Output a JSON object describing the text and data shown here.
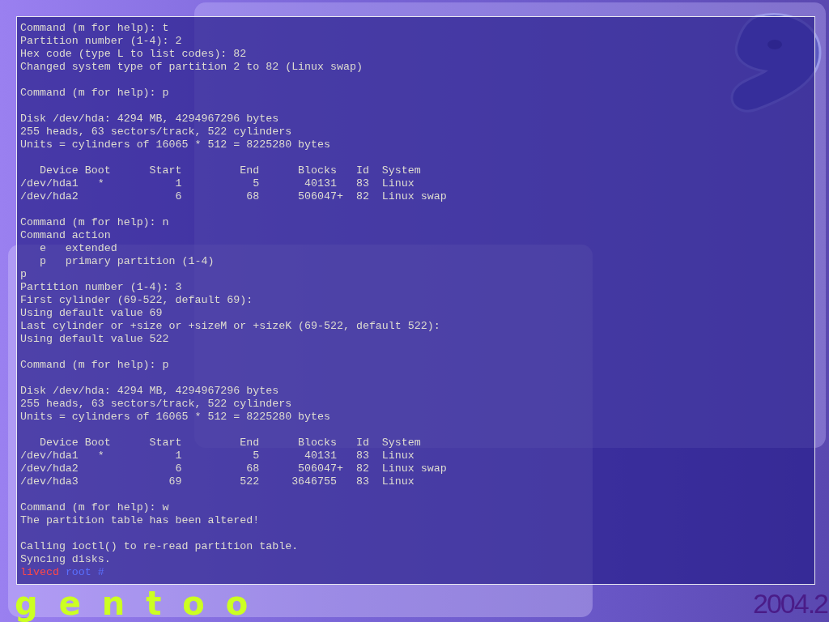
{
  "terminal": {
    "blocks": [
      [
        "Command (m for help): t",
        "Partition number (1-4): 2",
        "Hex code (type L to list codes): 82",
        "Changed system type of partition 2 to 82 (Linux swap)"
      ],
      [
        "Command (m for help): p"
      ],
      [
        "Disk /dev/hda: 4294 MB, 4294967296 bytes",
        "255 heads, 63 sectors/track, 522 cylinders",
        "Units = cylinders of 16065 * 512 = 8225280 bytes"
      ],
      [
        "   Device Boot      Start         End      Blocks   Id  System",
        "/dev/hda1   *           1           5       40131   83  Linux",
        "/dev/hda2               6          68      506047+  82  Linux swap"
      ],
      [
        "Command (m for help): n",
        "Command action",
        "   e   extended",
        "   p   primary partition (1-4)",
        "p",
        "Partition number (1-4): 3",
        "First cylinder (69-522, default 69):",
        "Using default value 69",
        "Last cylinder or +size or +sizeM or +sizeK (69-522, default 522):",
        "Using default value 522"
      ],
      [
        "Command (m for help): p"
      ],
      [
        "Disk /dev/hda: 4294 MB, 4294967296 bytes",
        "255 heads, 63 sectors/track, 522 cylinders",
        "Units = cylinders of 16065 * 512 = 8225280 bytes"
      ],
      [
        "   Device Boot      Start         End      Blocks   Id  System",
        "/dev/hda1   *           1           5       40131   83  Linux",
        "/dev/hda2               6          68      506047+  82  Linux swap",
        "/dev/hda3              69         522     3646755   83  Linux"
      ],
      [
        "Command (m for help): w",
        "The partition table has been altered!"
      ],
      [
        "Calling ioctl() to re-read partition table.",
        "Syncing disks."
      ]
    ],
    "prompt": {
      "host": "livecd",
      "user": "root",
      "symbol": "#"
    }
  },
  "branding": {
    "logo_text": "gentoo",
    "version": "2004.2"
  }
}
